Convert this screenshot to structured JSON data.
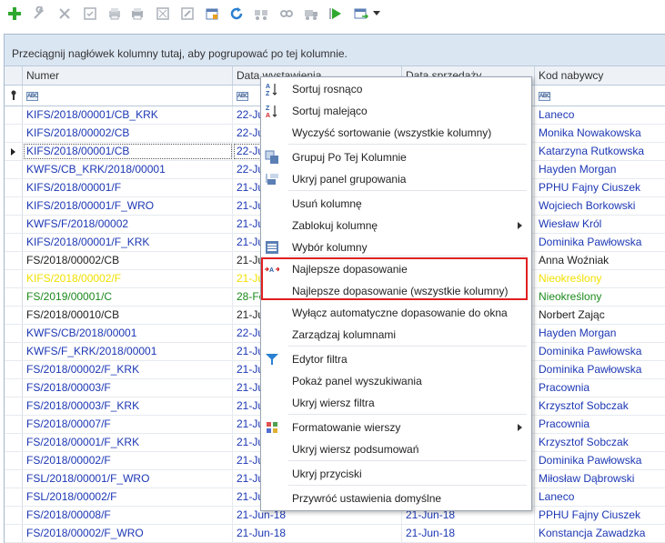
{
  "toolbar": {
    "buttons": [
      {
        "name": "add-icon",
        "x": "green plus"
      },
      {
        "name": "wrench-icon"
      },
      {
        "name": "delete-icon"
      },
      {
        "name": "form-icon"
      },
      {
        "name": "print-preview-icon"
      },
      {
        "name": "print-icon"
      },
      {
        "name": "document-icon"
      },
      {
        "name": "edit-document-icon"
      },
      {
        "name": "calendar-icon"
      },
      {
        "name": "refresh-icon"
      },
      {
        "name": "transfer-icon"
      },
      {
        "name": "link-icon"
      },
      {
        "name": "move-icon"
      },
      {
        "name": "run-icon"
      },
      {
        "name": "export-icon"
      }
    ]
  },
  "grid": {
    "group_panel_text": "Przeciągnij nagłówek kolumny tutaj, aby pogrupować po tej kolumnie.",
    "columns": [
      "Numer",
      "Data wystawienia",
      "Data sprzedaży",
      "Kod nabywcy"
    ],
    "rows": [
      {
        "numer": "KIFS/2018/00001/CB_KRK",
        "data": "22-Ju",
        "kod": "Laneco",
        "color": "blue"
      },
      {
        "numer": "KIFS/2018/00002/CB",
        "data": "22-Ju",
        "kod": "Monika Nowakowska",
        "color": "blue"
      },
      {
        "numer": "KIFS/2018/00001/CB",
        "data": "22-Ju",
        "kod": "Katarzyna Rutkowska",
        "color": "blue",
        "selected": true
      },
      {
        "numer": "KWFS/CB_KRK/2018/00001",
        "data": "22-Ju",
        "kod": "Hayden Morgan",
        "color": "blue"
      },
      {
        "numer": "KIFS/2018/00001/F",
        "data": "21-Ju",
        "kod": "PPHU Fajny Ciuszek",
        "color": "blue"
      },
      {
        "numer": "KIFS/2018/00001/F_WRO",
        "data": "21-Ju",
        "kod": "Wojciech Borkowski",
        "color": "blue"
      },
      {
        "numer": "KWFS/F/2018/00002",
        "data": "21-Ju",
        "kod": "Wiesław Król",
        "color": "blue"
      },
      {
        "numer": "KIFS/2018/00001/F_KRK",
        "data": "21-Ju",
        "kod": "Dominika Pawłowska",
        "color": "blue"
      },
      {
        "numer": "FS/2018/00002/CB",
        "data": "21-Ju",
        "kod": "Anna Woźniak",
        "color": "black"
      },
      {
        "numer": "KIFS/2018/00002/F",
        "data": "21-Ju",
        "kod": "Nieokreślony",
        "color": "yellow"
      },
      {
        "numer": "FS/2019/00001/C",
        "data": "28-Fe",
        "kod": "Nieokreślony",
        "color": "green"
      },
      {
        "numer": "FS/2018/00010/CB",
        "data": "21-Ju",
        "kod": "Norbert Zając",
        "color": "black"
      },
      {
        "numer": "KWFS/CB/2018/00001",
        "data": "22-Ju",
        "kod": "Hayden Morgan",
        "color": "blue"
      },
      {
        "numer": "KWFS/F_KRK/2018/00001",
        "data": "21-Ju",
        "kod": "Dominika Pawłowska",
        "color": "blue"
      },
      {
        "numer": "FS/2018/00002/F_KRK",
        "data": "21-Ju",
        "kod": "Dominika Pawłowska",
        "color": "blue"
      },
      {
        "numer": "FS/2018/00003/F",
        "data": "21-Ju",
        "kod": "Pracownia",
        "color": "blue"
      },
      {
        "numer": "FS/2018/00003/F_KRK",
        "data": "21-Ju",
        "kod": "Krzysztof Sobczak",
        "color": "blue"
      },
      {
        "numer": "FS/2018/00007/F",
        "data": "21-Ju",
        "kod": "Pracownia",
        "color": "blue"
      },
      {
        "numer": "FS/2018/00001/F_KRK",
        "data": "21-Ju",
        "kod": "Krzysztof Sobczak",
        "color": "blue"
      },
      {
        "numer": "FS/2018/00002/F",
        "data": "21-Ju",
        "kod": "Dominika Pawłowska",
        "color": "blue"
      },
      {
        "numer": "FSL/2018/00001/F_WRO",
        "data": "21-Ju",
        "kod": "Miłosław Dąbrowski",
        "color": "blue"
      },
      {
        "numer": "FSL/2018/00002/F",
        "data": "21-Ju",
        "kod": "Laneco",
        "color": "blue"
      },
      {
        "numer": "FS/2018/00008/F",
        "data": "21-Jun-18",
        "sprzedaz": "21-Jun-18",
        "kod": "PPHU Fajny Ciuszek",
        "color": "blue"
      },
      {
        "numer": "FS/2018/00002/F_WRO",
        "data": "21-Jun-18",
        "sprzedaz": "21-Jun-18",
        "kod": "Konstancja Zawadzka",
        "color": "blue"
      }
    ]
  },
  "context_menu": {
    "items": [
      {
        "label": "Sortuj rosnąco",
        "icon": "sort-ascending-icon"
      },
      {
        "label": "Sortuj malejąco",
        "icon": "sort-descending-icon"
      },
      {
        "label": "Wyczyść sortowanie (wszystkie kolumny)",
        "icon": ""
      },
      {
        "label": "Grupuj Po Tej Kolumnie",
        "icon": "group-icon",
        "sep": true
      },
      {
        "label": "Ukryj panel grupowania",
        "icon": "group-panel-icon"
      },
      {
        "label": "Usuń kolumnę",
        "icon": "",
        "sep": true
      },
      {
        "label": "Zablokuj kolumnę",
        "icon": "",
        "submenu": true
      },
      {
        "label": "Wybór kolumny",
        "icon": "column-chooser-icon"
      },
      {
        "label": "Najlepsze dopasowanie",
        "icon": "best-fit-icon",
        "sep": true
      },
      {
        "label": "Najlepsze dopasowanie (wszystkie kolumny)",
        "icon": ""
      },
      {
        "label": "Wyłącz automatyczne dopasowanie do okna",
        "icon": ""
      },
      {
        "label": "Zarządzaj kolumnami",
        "icon": ""
      },
      {
        "label": "Edytor filtra",
        "icon": "filter-icon",
        "sep": true
      },
      {
        "label": "Pokaż panel wyszukiwania",
        "icon": ""
      },
      {
        "label": "Ukryj wiersz filtra",
        "icon": ""
      },
      {
        "label": "Formatowanie wierszy",
        "icon": "format-rows-icon",
        "sep": true,
        "submenu": true
      },
      {
        "label": "Ukryj wiersz podsumowań",
        "icon": ""
      },
      {
        "label": "Ukryj przyciski",
        "icon": "",
        "sep": true
      },
      {
        "label": "Przywróć ustawienia domyślne",
        "icon": "",
        "sep": true
      }
    ]
  },
  "colors": {
    "accent": "#1c37b4",
    "highlight": "#e12020",
    "header_bg": "#dbe6f3"
  }
}
